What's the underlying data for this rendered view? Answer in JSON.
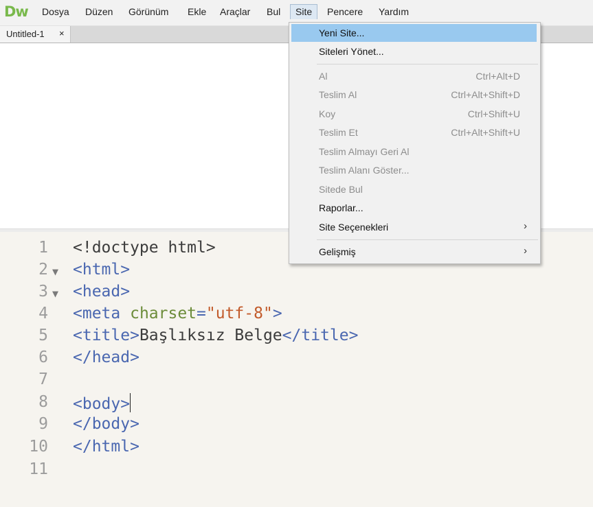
{
  "app": {
    "logo": "Dw"
  },
  "menubar": {
    "items": [
      "Dosya",
      "Düzen",
      "Görünüm",
      "Ekle",
      "Araçlar",
      "Bul",
      "Site",
      "Pencere",
      "Yardım"
    ],
    "active": "Site"
  },
  "tabs": [
    {
      "label": "Untitled-1",
      "close": "×"
    }
  ],
  "site_menu": {
    "items": [
      {
        "label": "Yeni Site...",
        "shortcut": "",
        "enabled": true,
        "highlighted": true
      },
      {
        "label": "Siteleri Yönet...",
        "shortcut": "",
        "enabled": true
      },
      {
        "label": "Al",
        "shortcut": "Ctrl+Alt+D",
        "enabled": false
      },
      {
        "label": "Teslim Al",
        "shortcut": "Ctrl+Alt+Shift+D",
        "enabled": false
      },
      {
        "label": "Koy",
        "shortcut": "Ctrl+Shift+U",
        "enabled": false
      },
      {
        "label": "Teslim Et",
        "shortcut": "Ctrl+Alt+Shift+U",
        "enabled": false
      },
      {
        "label": "Teslim Almayı Geri Al",
        "shortcut": "",
        "enabled": false
      },
      {
        "label": "Teslim Alanı Göster...",
        "shortcut": "",
        "enabled": false
      },
      {
        "label": "Sitede Bul",
        "shortcut": "",
        "enabled": false
      },
      {
        "label": "Raporlar...",
        "shortcut": "",
        "enabled": true
      },
      {
        "label": "Site Seçenekleri",
        "shortcut": "",
        "enabled": true,
        "submenu": "›"
      },
      {
        "label": "Gelişmiş",
        "shortcut": "",
        "enabled": true,
        "submenu": "›"
      }
    ]
  },
  "code": {
    "lines": [
      {
        "n": "1",
        "fold": "",
        "text": "<!doctype html>"
      },
      {
        "n": "2",
        "fold": "▼",
        "text": "<html>"
      },
      {
        "n": "3",
        "fold": "▼",
        "text": "<head>"
      },
      {
        "n": "4",
        "fold": "",
        "text": "<meta charset=\"utf-8\">"
      },
      {
        "n": "5",
        "fold": "",
        "text": "<title>Başlıksız Belge</title>"
      },
      {
        "n": "6",
        "fold": "",
        "text": "</head>"
      },
      {
        "n": "7",
        "fold": "",
        "text": ""
      },
      {
        "n": "8",
        "fold": "",
        "text": "<body>"
      },
      {
        "n": "9",
        "fold": "",
        "text": "</body>"
      },
      {
        "n": "10",
        "fold": "",
        "text": "</html>"
      },
      {
        "n": "11",
        "fold": "",
        "text": ""
      }
    ],
    "tokens": {
      "doctype": "<!doctype html>",
      "html_open": "<html>",
      "head_open": "<head>",
      "meta_open": "<meta ",
      "meta_attr": "charset",
      "meta_eq": "=",
      "meta_val": "\"utf-8\"",
      "meta_close": ">",
      "title_open": "<title>",
      "title_text": "Başlıksız Belge",
      "title_close": "</title>",
      "head_close": "</head>",
      "body_open": "<body>",
      "body_close": "</body>",
      "html_close": "</html>"
    }
  },
  "colors": {
    "logo": "#79b94c",
    "tag": "#4a67b0",
    "attribute": "#6c8c3a",
    "string": "#c25b2b",
    "menu_highlight": "#99c9ef",
    "code_background": "#f6f4ef"
  }
}
